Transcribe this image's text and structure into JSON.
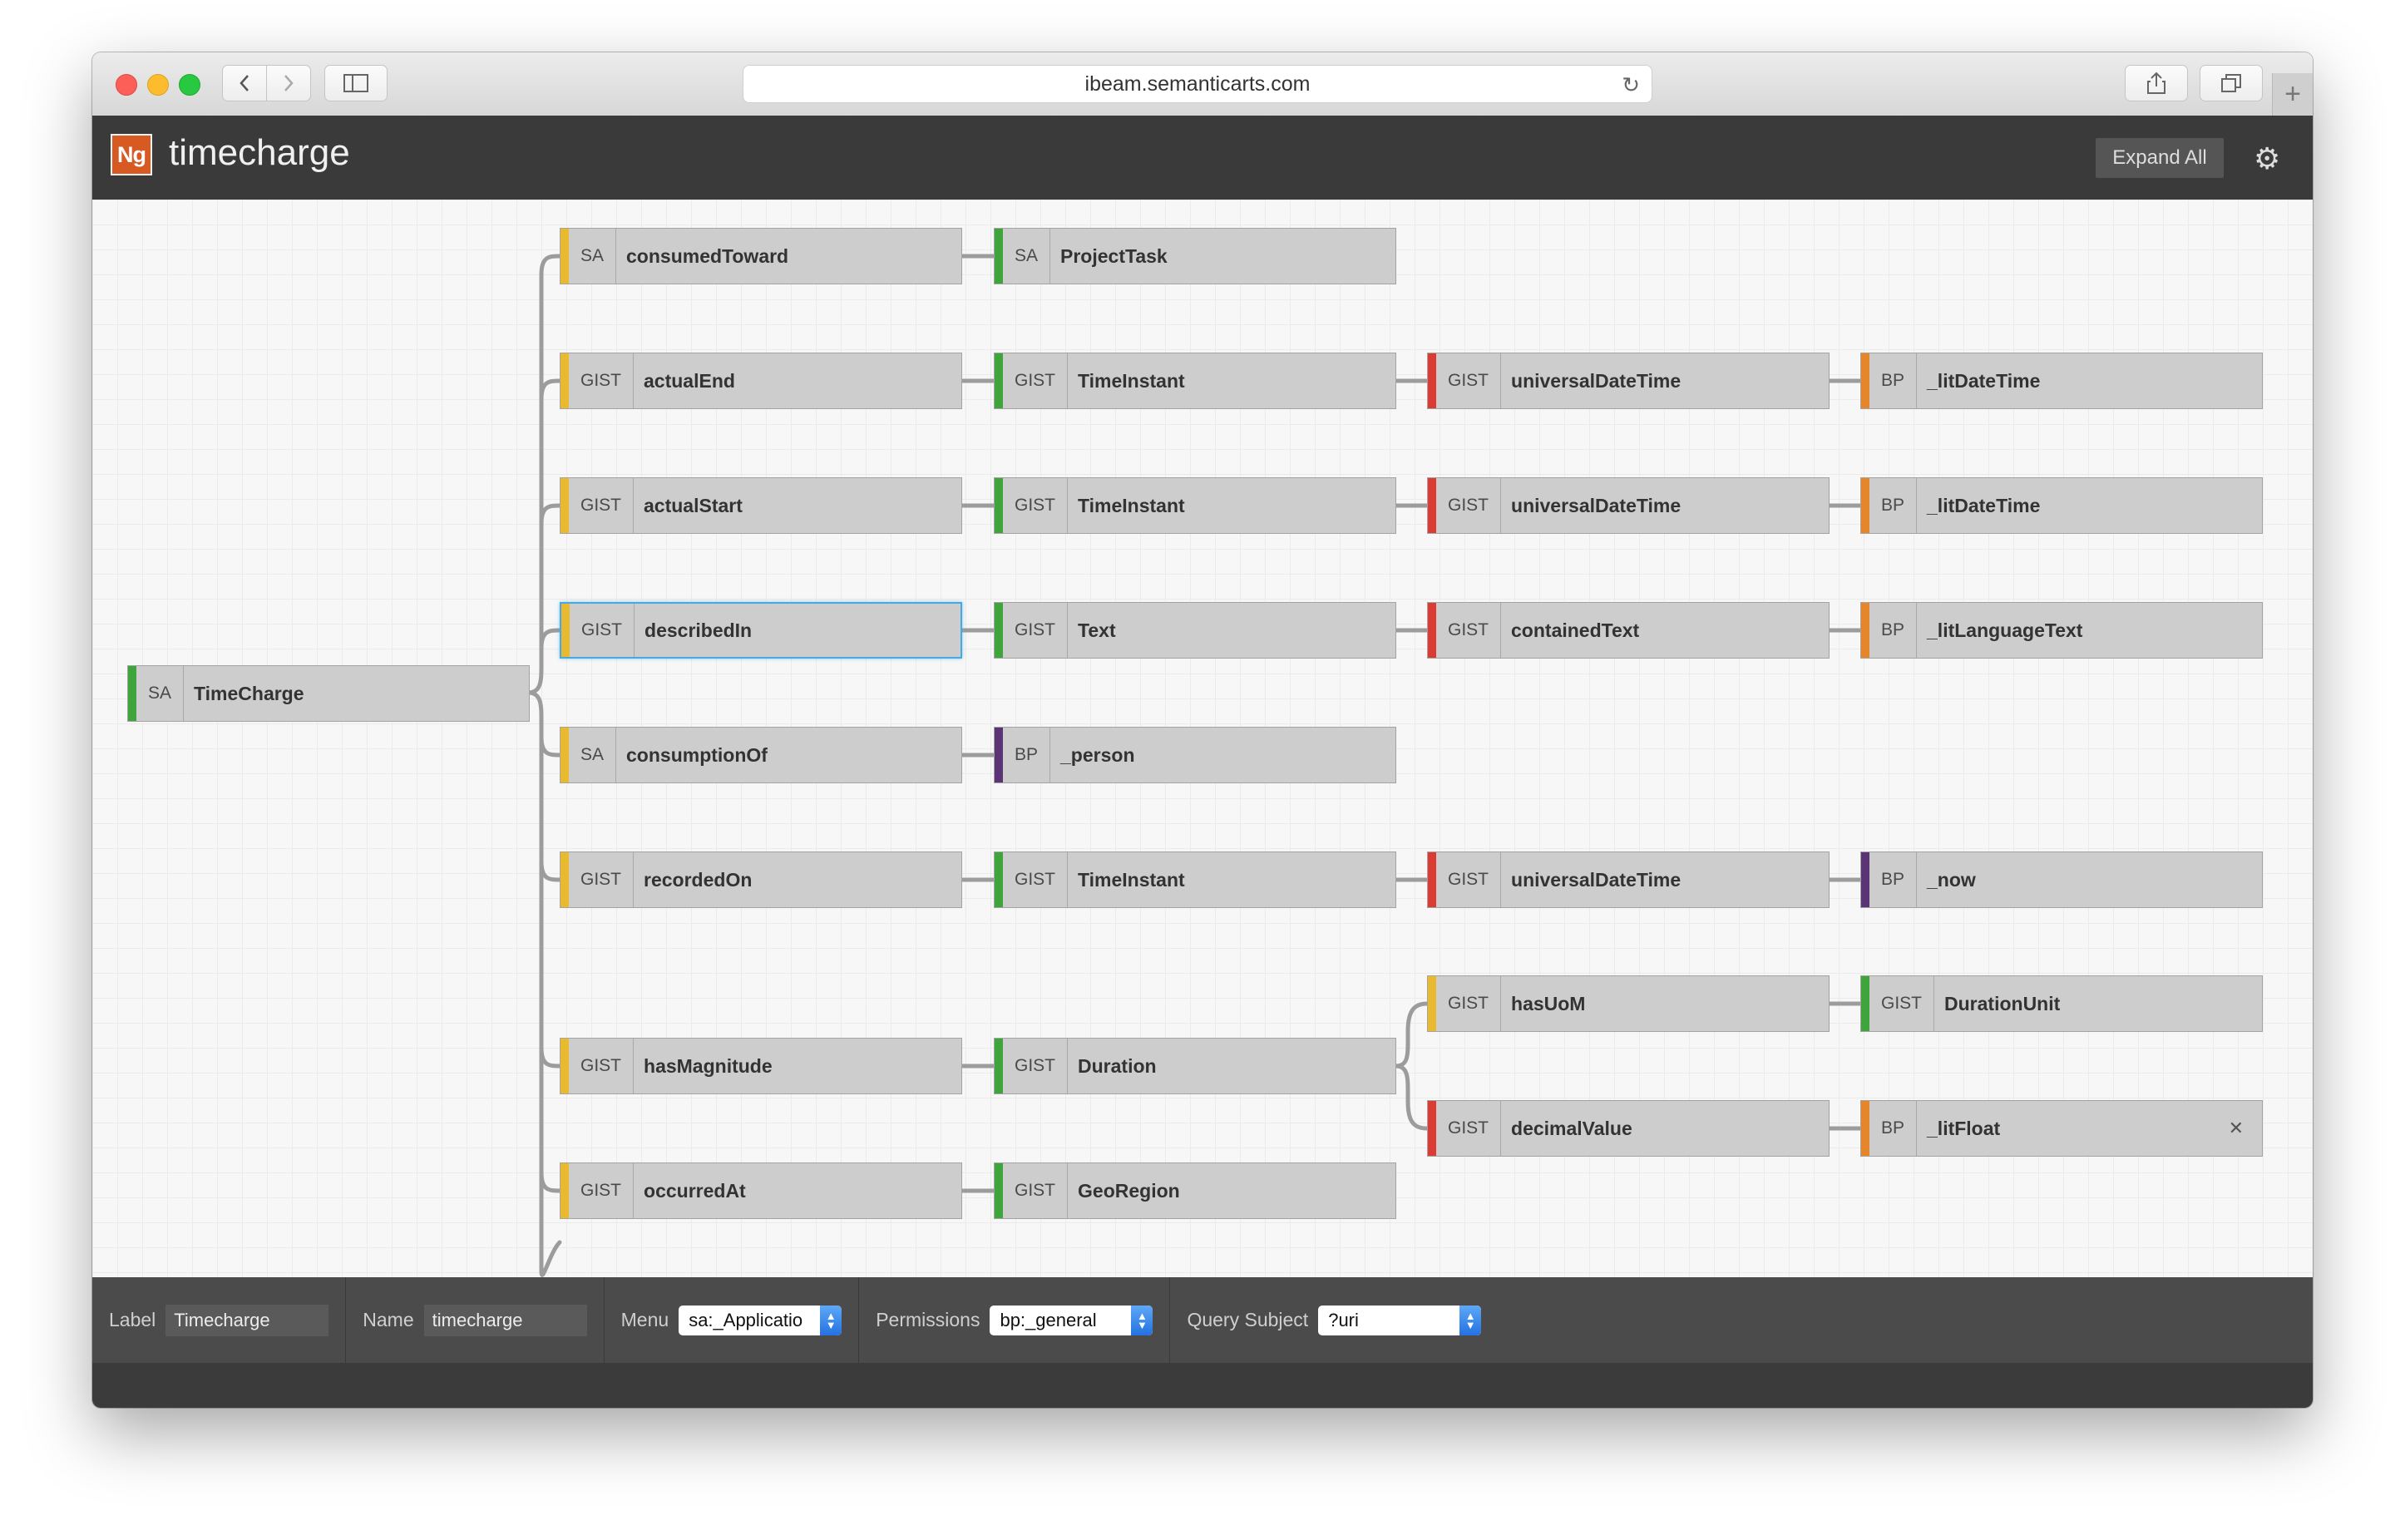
{
  "browser": {
    "url": "ibeam.semanticarts.com"
  },
  "app": {
    "logo_text": "Ng",
    "title": "timecharge",
    "expand_all_label": "Expand All",
    "settings_icon": "gear-icon"
  },
  "colors": {
    "yellow": "#e9b930",
    "green": "#3fa43b",
    "red": "#db3b33",
    "orange": "#e5862a",
    "purple": "#5a3475",
    "selected_border": "#46a8e6"
  },
  "nodes": {
    "root": {
      "prefix": "SA",
      "label": "TimeCharge"
    },
    "r1c1": {
      "prefix": "SA",
      "label": "consumedToward"
    },
    "r1c2": {
      "prefix": "SA",
      "label": "ProjectTask"
    },
    "r2c1": {
      "prefix": "GIST",
      "label": "actualEnd"
    },
    "r2c2": {
      "prefix": "GIST",
      "label": "TimeInstant"
    },
    "r2c3": {
      "prefix": "GIST",
      "label": "universalDateTime"
    },
    "r2c4": {
      "prefix": "BP",
      "label": "_litDateTime"
    },
    "r3c1": {
      "prefix": "GIST",
      "label": "actualStart"
    },
    "r3c2": {
      "prefix": "GIST",
      "label": "TimeInstant"
    },
    "r3c3": {
      "prefix": "GIST",
      "label": "universalDateTime"
    },
    "r3c4": {
      "prefix": "BP",
      "label": "_litDateTime"
    },
    "r4c1": {
      "prefix": "GIST",
      "label": "describedIn"
    },
    "r4c2": {
      "prefix": "GIST",
      "label": "Text"
    },
    "r4c3": {
      "prefix": "GIST",
      "label": "containedText"
    },
    "r4c4": {
      "prefix": "BP",
      "label": "_litLanguageText"
    },
    "r5c1": {
      "prefix": "SA",
      "label": "consumptionOf"
    },
    "r5c2": {
      "prefix": "BP",
      "label": "_person"
    },
    "r6c1": {
      "prefix": "GIST",
      "label": "recordedOn"
    },
    "r6c2": {
      "prefix": "GIST",
      "label": "TimeInstant"
    },
    "r6c3": {
      "prefix": "GIST",
      "label": "universalDateTime"
    },
    "r6c4": {
      "prefix": "BP",
      "label": "_now"
    },
    "r7c1": {
      "prefix": "GIST",
      "label": "hasMagnitude"
    },
    "r7c2": {
      "prefix": "GIST",
      "label": "Duration"
    },
    "r7c3a": {
      "prefix": "GIST",
      "label": "hasUoM"
    },
    "r7c4a": {
      "prefix": "GIST",
      "label": "DurationUnit"
    },
    "r7c3b": {
      "prefix": "GIST",
      "label": "decimalValue"
    },
    "r7c4b": {
      "prefix": "BP",
      "label": "_litFloat"
    },
    "r8c1": {
      "prefix": "GIST",
      "label": "occurredAt"
    },
    "r8c2": {
      "prefix": "GIST",
      "label": "GeoRegion"
    }
  },
  "footer": {
    "label_caption": "Label",
    "label_value": "Timecharge",
    "name_caption": "Name",
    "name_value": "timecharge",
    "menu_caption": "Menu",
    "menu_value": "sa:_Applicatio",
    "permissions_caption": "Permissions",
    "permissions_value": "bp:_general",
    "query_caption": "Query Subject",
    "query_value": "?uri"
  }
}
